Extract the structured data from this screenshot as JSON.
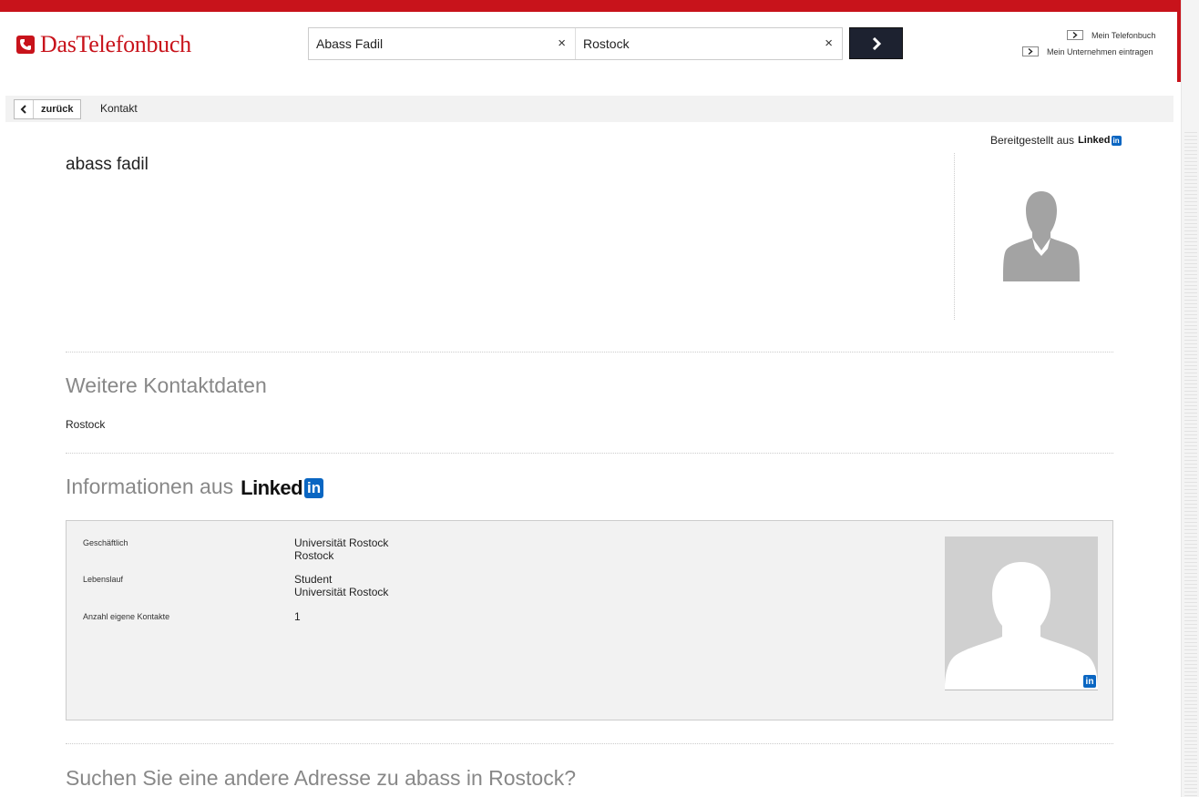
{
  "header": {
    "logo_text": "DasTelefonbuch",
    "search": {
      "name_value": "Abass Fadil",
      "city_value": "Rostock",
      "clear_symbol": "×"
    },
    "links": [
      "Mein Telefonbuch",
      "Mein Unternehmen eintragen"
    ]
  },
  "nav": {
    "back_label": "zurück",
    "breadcrumb": "Kontakt"
  },
  "profile": {
    "provided_label": "Bereitgestellt aus",
    "linkedin_word": "Linked",
    "linkedin_in": "in",
    "name": "abass fadil"
  },
  "contact": {
    "heading": "Weitere Kontaktdaten",
    "city": "Rostock"
  },
  "linkedin_info": {
    "heading": "Informationen aus",
    "rows": [
      {
        "label": "Geschäftlich",
        "line1": "Universität Rostock",
        "line2": "Rostock"
      },
      {
        "label": "Lebenslauf",
        "line1": "Student",
        "line2": "Universität Rostock"
      },
      {
        "label": "Anzahl eigene Kontakte",
        "line1": "1",
        "line2": ""
      }
    ]
  },
  "other_search": {
    "heading": "Suchen Sie eine andere Adresse zu abass in Rostock?"
  },
  "colors": {
    "brand_red": "#c8131b",
    "linkedin_blue": "#0a66c2",
    "search_button": "#1d2230"
  }
}
